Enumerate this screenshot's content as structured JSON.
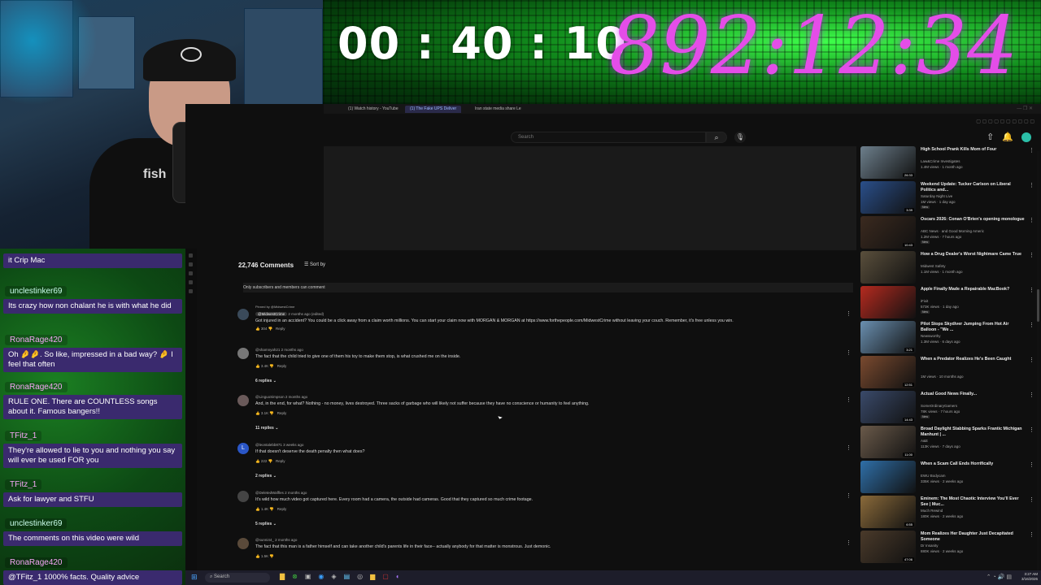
{
  "overlay": {
    "stream_timer": "00 : 40 : 10",
    "big_timer": "892:12:34",
    "cam_shirt_text": "fish"
  },
  "chat": {
    "messages": [
      {
        "user": "",
        "text": "it Crip Mac"
      },
      {
        "user": "unclestinker69",
        "text": "Its crazy how non chalant he is with what he did"
      },
      {
        "user": "RonaRage420",
        "text": "Oh 🤌🤌. So like, impressed in a bad way? 🤌 I feel that often"
      },
      {
        "user": "RonaRage420",
        "text": "RULE ONE. There are COUNTLESS songs about it. Famous bangers!!"
      },
      {
        "user": "TFitz_1",
        "text": "They're allowed to lie to you and nothing you say will ever be used FOR you"
      },
      {
        "user": "TFitz_1",
        "text": "Ask for lawyer and STFU"
      },
      {
        "user": "unclestinker69",
        "text": "The comments on this video were wild"
      },
      {
        "user": "RonaRage420",
        "text": "@TFitz_1 1000% facts. Quality advice"
      }
    ]
  },
  "browser": {
    "tabs": [
      {
        "label": "(1) Watch history - YouTube",
        "active": false
      },
      {
        "label": "(1) The Fake UPS Deliver",
        "active": true
      },
      {
        "label": "Iran state media share Le",
        "active": false
      }
    ],
    "search_placeholder": "Search",
    "search_icon": "search-icon",
    "mic_icon": "mic-icon"
  },
  "comments_section": {
    "count": "22,746 Comments",
    "sort_label": "Sort by",
    "notice": "Only subscribers and members can comment",
    "comments": [
      {
        "pinned": "Pinned by @MidwestCrime",
        "author": "@MidwestCrime",
        "time": "2 months ago (edited)",
        "text": "Got injured in an accident? You could be a click away from a claim worth millions. You can start your claim now with MORGAN & MORGAN at https://www.forthepeople.com/MidwestCrime without leaving your couch. Remember, it's free unless you win.",
        "likes": "304",
        "reply": "Reply",
        "replies": ""
      },
      {
        "author": "@shamnyah21",
        "time": "2 months ago",
        "text": "The fact that the child tried to give one of them his toy to make them stop, is what crushed me on the inside.",
        "likes": "3.4K",
        "reply": "Reply",
        "replies": "6 replies"
      },
      {
        "author": "@LinguoSimpson",
        "time": "2 months ago",
        "text": "And, in the end, for what? Nothing - no money, lives destroyed. Three sacks of garbage who will likely not suffer because they have no conscience or humanity to feel anything.",
        "likes": "3.1K",
        "reply": "Reply",
        "replies": "11 replies"
      },
      {
        "author": "@leontalebb871",
        "time": "3 weeks ago",
        "text": "If that doesn't deserve the death penalty then what does?",
        "likes": "222",
        "reply": "Reply",
        "replies": "2 replies"
      },
      {
        "author": "@DeletedWaffles",
        "time": "2 months ago",
        "text": "It's wild how much video got captured here. Every room had a camera, the outside had cameras. Good that they captured so much crime footage.",
        "likes": "1.4K",
        "reply": "Reply",
        "replies": "5 replies"
      },
      {
        "author": "@sunni44_",
        "time": "2 months ago",
        "text": "The fact that this man is a father himself and can take another child's parents life in their face-- actually anybody for that matter is monstrous. Just demonic.",
        "likes": "1.5K",
        "reply": "Reply",
        "replies": ""
      }
    ]
  },
  "recommendations": [
    {
      "title": "High School Prank Kills Mom of Four",
      "channel": "Law&Crime Investigates",
      "stats": "1.4M views · 1 month ago",
      "duration": "26:33",
      "new": "",
      "color": "#6d7f8c"
    },
    {
      "title": "Weekend Update: Tucker Carlson on Liberal Politics and...",
      "channel": "Saturday Night Live",
      "stats": "1M views · 1 day ago",
      "duration": "3:39",
      "new": "New",
      "color": "#2a4f8a"
    },
    {
      "title": "Oscars 2026: Conan O'Brien's opening monologue",
      "channel": "ABC News · and Good Morning Americ",
      "stats": "1.2M views · 7 hours ago",
      "duration": "10:43",
      "new": "New",
      "color": "#3b2a1f"
    },
    {
      "title": "How a Drug Dealer's Worst Nightmare Came True",
      "channel": "Midwest Safety",
      "stats": "1.1M views · 1 month ago",
      "duration": "",
      "new": "",
      "color": "#5a4f3c"
    },
    {
      "title": "Apple Finally Made a Repairable MacBook?",
      "channel": "iFixit",
      "stats": "573K views · 1 day ago",
      "duration": "",
      "new": "New",
      "color": "#b52a1f"
    },
    {
      "title": "Pilot Stops Skydiver Jumping From Hot Air Balloon - \"We ...",
      "channel": "Newsworthy",
      "stats": "1.3M views · 6 days ago",
      "duration": "3:21",
      "new": "",
      "color": "#6a8fb0"
    },
    {
      "title": "When a Predator Realizes He's Been Caught",
      "channel": "",
      "stats": "1M views · 10 months ago",
      "duration": "12:51",
      "new": "",
      "color": "#7a4a2f"
    },
    {
      "title": "Actual Good News Finally...",
      "channel": "SomeOrdinaryGamers",
      "stats": "78K views · 7 hours ago",
      "duration": "14:43",
      "new": "New",
      "color": "#3a4a6a"
    },
    {
      "title": "Broad Daylight Stabbing Sparks Frantic Michigan Manhunt | ...",
      "channel": "A&E",
      "stats": "113K views · 7 days ago",
      "duration": "11:00",
      "new": "",
      "color": "#6a5a4a"
    },
    {
      "title": "When a Scam Call Ends Horrifically",
      "channel": "EWU Bodycam",
      "stats": "335K views · 2 weeks ago",
      "duration": "",
      "new": "",
      "color": "#2f6fa8"
    },
    {
      "title": "Eminem: The Most Chaotic Interview You'll Ever See | Muc...",
      "channel": "Much Rewind",
      "stats": "180K views · 2 weeks ago",
      "duration": "6:55",
      "new": "",
      "color": "#8a6a3a"
    },
    {
      "title": "Mom Realizes Her Daughter Just Decapitated Someone",
      "channel": "Dr Insanity",
      "stats": "880K views · 2 weeks ago",
      "duration": "47:06",
      "new": "",
      "color": "#4a3a2a"
    }
  ],
  "taskbar": {
    "search": "Search",
    "time": "3:27 AM",
    "date": "3/16/2026"
  }
}
